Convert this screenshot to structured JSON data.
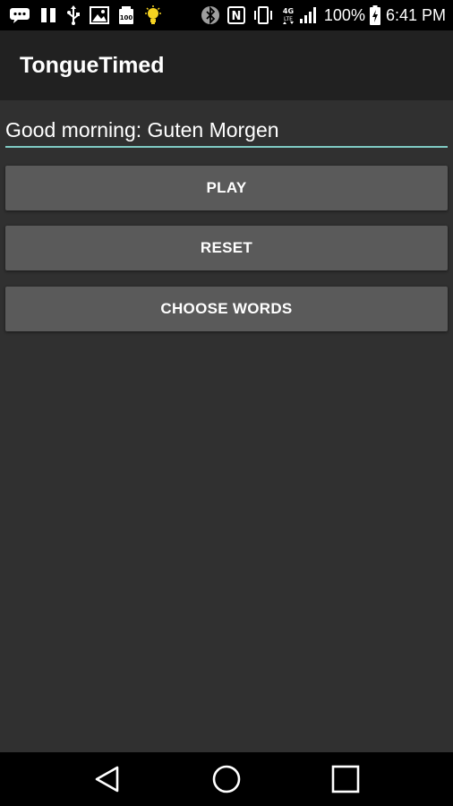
{
  "status_bar": {
    "battery_percent": "100%",
    "time": "6:41 PM",
    "network_label": "4G LTE"
  },
  "app_bar": {
    "title": "TongueTimed"
  },
  "main": {
    "phrase_field": {
      "value": "Good morning: Guten Morgen"
    },
    "buttons": {
      "play": "PLAY",
      "reset": "RESET",
      "choose_words": "CHOOSE WORDS"
    }
  },
  "colors": {
    "background": "#303030",
    "app_bar": "#212121",
    "button": "#5a5a5a",
    "field_underline": "#80cbc4",
    "status_bar": "#000000"
  }
}
